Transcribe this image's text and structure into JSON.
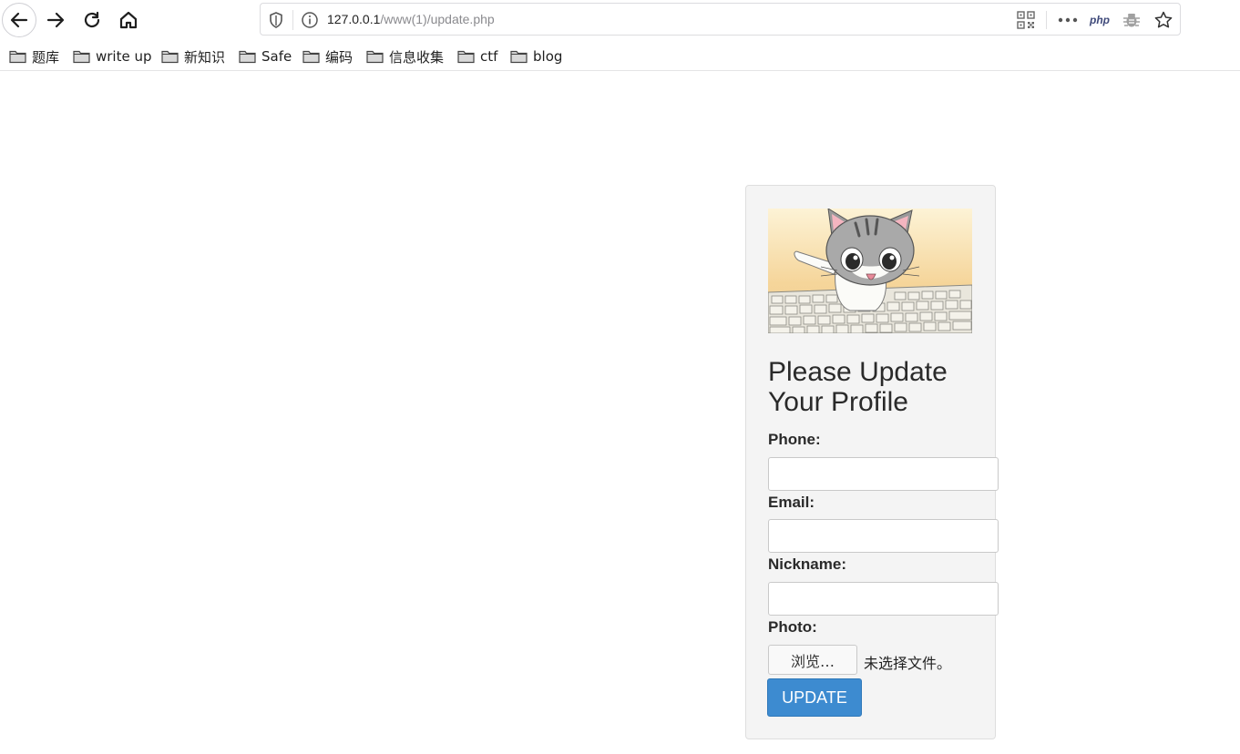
{
  "browser": {
    "url_host": "127.0.0.1",
    "url_path": "/www(1)/update.php",
    "toolbar_icons": [
      "back-icon",
      "forward-icon",
      "reload-icon",
      "home-icon"
    ],
    "url_icons": [
      "shield-icon",
      "info-icon",
      "qr-code-icon",
      "more-icon",
      "php-icon",
      "bug-icon",
      "star-icon"
    ],
    "php_label": "php"
  },
  "bookmarks": [
    {
      "label": "题库"
    },
    {
      "label": "write up"
    },
    {
      "label": "新知识"
    },
    {
      "label": "Safe"
    },
    {
      "label": "编码"
    },
    {
      "label": "信息收集"
    },
    {
      "label": "ctf"
    },
    {
      "label": "blog"
    }
  ],
  "form": {
    "title": "Please Update Your Profile",
    "phone_label": "Phone:",
    "phone_value": "",
    "email_label": "Email:",
    "email_value": "",
    "nickname_label": "Nickname:",
    "nickname_value": "",
    "photo_label": "Photo:",
    "browse_label": "浏览…",
    "file_status": "未选择文件。",
    "submit_label": "UPDATE"
  },
  "colors": {
    "accent": "#3d8bd0",
    "card_bg": "#f4f4f4"
  }
}
